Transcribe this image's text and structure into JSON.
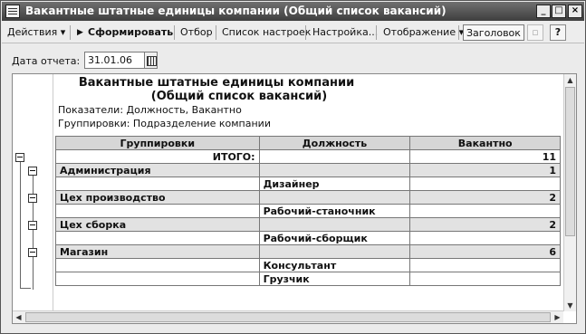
{
  "window": {
    "title": "Вакантные штатные единицы компании (Общий список вакансий)",
    "min": "_",
    "max": "□",
    "close": "×"
  },
  "toolbar": {
    "actions": "Действия ▾",
    "generate": "Сформировать",
    "filter": "Отбор",
    "settings_list": "Список настроек",
    "settings": "Настройка...",
    "display": "Отображение ▾",
    "header": "Заголовок",
    "help": "?"
  },
  "date": {
    "label": "Дата отчета:",
    "value": "31.01.06"
  },
  "report": {
    "title_line1": "Вакантные штатные единицы компании",
    "title_line2": "(Общий список вакансий)",
    "indicators": "Показатели:  Должность, Вакантно",
    "groupings": "Группировки:  Подразделение компании",
    "columns": [
      "Группировки",
      "Должность",
      "Вакантно"
    ],
    "total": {
      "label": "ИТОГО:",
      "value": "11"
    },
    "rows": [
      {
        "type": "group",
        "name": "Администрация",
        "value": "1"
      },
      {
        "type": "item",
        "name": "Дизайнер"
      },
      {
        "type": "group",
        "name": "Цех производство",
        "value": "2"
      },
      {
        "type": "item",
        "name": "Рабочий-станочник"
      },
      {
        "type": "group",
        "name": "Цех сборка",
        "value": "2"
      },
      {
        "type": "item",
        "name": "Рабочий-сборщик"
      },
      {
        "type": "group",
        "name": "Магазин",
        "value": "6"
      },
      {
        "type": "item",
        "name": "Консультант"
      },
      {
        "type": "item",
        "name": "Грузчик"
      }
    ]
  }
}
